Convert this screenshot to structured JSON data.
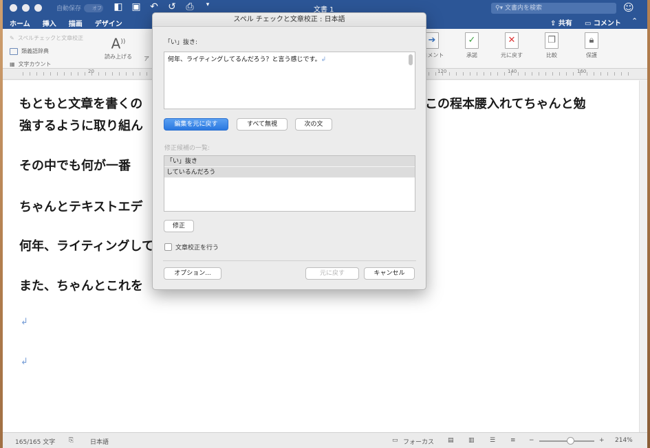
{
  "titlebar": {
    "autosave_label": "自動保存",
    "autosave_state": "オフ",
    "document_title": "文書 1",
    "search_placeholder": "文書内を検索",
    "share_label": "共有",
    "comment_label": "コメント"
  },
  "tabs": [
    "ホーム",
    "挿入",
    "描画",
    "デザイン"
  ],
  "ribbon": {
    "spellcheck_label": "スペルチェックと文章校正",
    "thesaurus_label": "類義語辞典",
    "wordcount_label": "文字カウント",
    "readaloud_label": "読み上げる",
    "a_label": "ア",
    "comment_fragment": "/コメント",
    "accept_label": "承諾",
    "reject_label": "元に戻す",
    "compare_label": "比較",
    "protect_label": "保護"
  },
  "ruler": {
    "marks": [
      "20",
      "120",
      "140",
      "160"
    ]
  },
  "document": {
    "line1_left": "もともと文章を書くの",
    "line1_right": "この程本腰入れてちゃんと勉",
    "line2": "強するように取り組ん",
    "line3": "その中でも何が一番",
    "line4": "ちゃんとテキストエデ",
    "line5": "何年、ライティングして",
    "line6": "また、ちゃんとこれを",
    "pilcrow": "↲"
  },
  "dialog": {
    "title": "スペル チェックと文章校正 : 日本語",
    "issue_label": "「い」抜き:",
    "sentence": "何年、ライティングしてるんだろう？と言う感じです。",
    "buttons": {
      "undo_edit": "編集を元に戻す",
      "ignore_all": "すべて無視",
      "next_sentence": "次の文",
      "correct": "修正",
      "options": "オプション...",
      "restore": "元に戻す",
      "cancel": "キャンセル"
    },
    "suggestions_label": "修正候補の一覧:",
    "suggestions": [
      "「い」抜き",
      "しているんだろう"
    ],
    "grammar_check_label": "文章校正を行う"
  },
  "statusbar": {
    "word_count": "165/165 文字",
    "language": "日本語",
    "focus": "フォーカス",
    "zoom": "214%"
  },
  "colors": {
    "titlebar": "#2c5697",
    "primary_button": "#2a78e0",
    "pilcrow": "#7aa0d8"
  }
}
